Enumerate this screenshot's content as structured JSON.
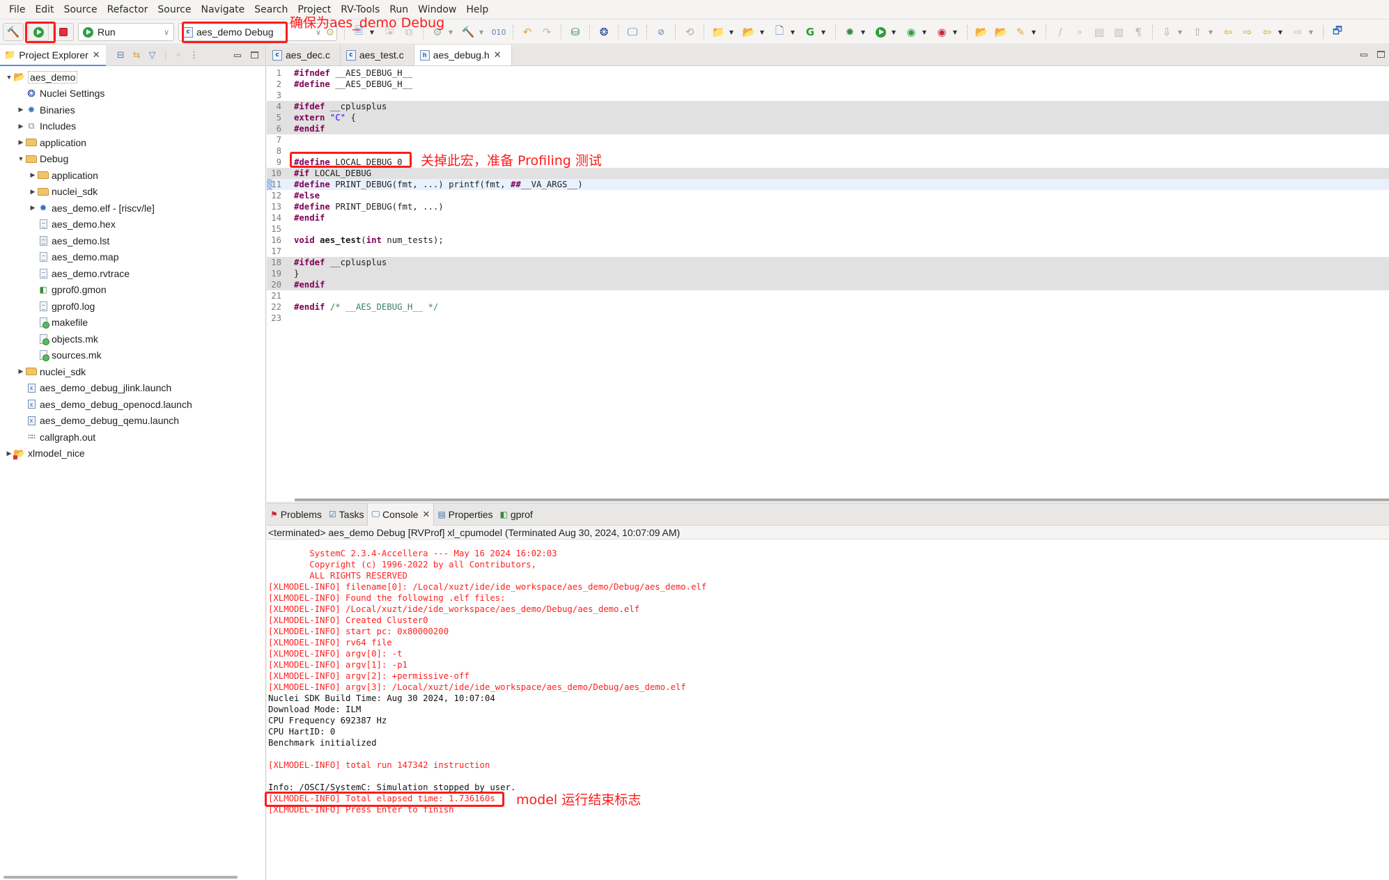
{
  "menu": [
    "File",
    "Edit",
    "Source",
    "Refactor",
    "Source",
    "Navigate",
    "Search",
    "Project",
    "RV-Tools",
    "Run",
    "Window",
    "Help"
  ],
  "toolbar": {
    "build_icon": "hammer-icon",
    "run_button_icon": "play-icon",
    "stop_button_icon": "stop-icon",
    "launch_mode": "Run",
    "launch_config": "aes_demo Debug"
  },
  "annotations": {
    "config_note": "确保为aes_demo Debug",
    "macro_note": "关掉此宏，准备 Profiling 测试",
    "finish_note": "model 运行结束标志",
    "color": "#ff1a1a"
  },
  "project_explorer": {
    "title": "Project Explorer",
    "items": [
      {
        "label": "aes_demo",
        "depth": 0,
        "twist": "open",
        "icon": "c-project-icon"
      },
      {
        "label": "Nuclei Settings",
        "depth": 1,
        "twist": "none",
        "icon": "nuclei-settings-icon"
      },
      {
        "label": "Binaries",
        "depth": 1,
        "twist": "closed",
        "icon": "binaries-icon"
      },
      {
        "label": "Includes",
        "depth": 1,
        "twist": "closed",
        "icon": "includes-icon"
      },
      {
        "label": "application",
        "depth": 1,
        "twist": "closed",
        "icon": "folder-icon"
      },
      {
        "label": "Debug",
        "depth": 1,
        "twist": "open",
        "icon": "folder-icon"
      },
      {
        "label": "application",
        "depth": 2,
        "twist": "closed",
        "icon": "folder-icon"
      },
      {
        "label": "nuclei_sdk",
        "depth": 2,
        "twist": "closed",
        "icon": "folder-icon"
      },
      {
        "label": "aes_demo.elf - [riscv/le]",
        "depth": 2,
        "twist": "closed",
        "icon": "elf-binary-icon"
      },
      {
        "label": "aes_demo.hex",
        "depth": 2,
        "twist": "none",
        "icon": "file-icon"
      },
      {
        "label": "aes_demo.lst",
        "depth": 2,
        "twist": "none",
        "icon": "listing-file-icon"
      },
      {
        "label": "aes_demo.map",
        "depth": 2,
        "twist": "none",
        "icon": "file-icon"
      },
      {
        "label": "aes_demo.rvtrace",
        "depth": 2,
        "twist": "none",
        "icon": "file-icon"
      },
      {
        "label": "gprof0.gmon",
        "depth": 2,
        "twist": "none",
        "icon": "gprof-icon"
      },
      {
        "label": "gprof0.log",
        "depth": 2,
        "twist": "none",
        "icon": "file-icon"
      },
      {
        "label": "makefile",
        "depth": 2,
        "twist": "none",
        "icon": "makefile-icon"
      },
      {
        "label": "objects.mk",
        "depth": 2,
        "twist": "none",
        "icon": "makefile-icon"
      },
      {
        "label": "sources.mk",
        "depth": 2,
        "twist": "none",
        "icon": "makefile-icon"
      },
      {
        "label": "nuclei_sdk",
        "depth": 1,
        "twist": "closed",
        "icon": "folder-icon"
      },
      {
        "label": "aes_demo_debug_jlink.launch",
        "depth": 1,
        "twist": "none",
        "icon": "launch-file-icon"
      },
      {
        "label": "aes_demo_debug_openocd.launch",
        "depth": 1,
        "twist": "none",
        "icon": "launch-file-icon"
      },
      {
        "label": "aes_demo_debug_qemu.launch",
        "depth": 1,
        "twist": "none",
        "icon": "launch-file-icon"
      },
      {
        "label": "callgraph.out",
        "depth": 1,
        "twist": "none",
        "icon": "binary-data-icon"
      },
      {
        "label": "xlmodel_nice",
        "depth": 0,
        "twist": "closed",
        "icon": "c-project-error-icon"
      }
    ]
  },
  "editor": {
    "tabs": [
      {
        "label": "aes_dec.c",
        "type": "c",
        "active": false
      },
      {
        "label": "aes_test.c",
        "type": "c",
        "active": false
      },
      {
        "label": "aes_debug.h",
        "type": "h",
        "active": true
      }
    ],
    "lines": [
      {
        "n": "1",
        "segs": [
          [
            "kw",
            "#ifndef"
          ],
          [
            "",
            " __AES_DEBUG_H__"
          ]
        ],
        "bg": ""
      },
      {
        "n": "2",
        "segs": [
          [
            "kw",
            "#define"
          ],
          [
            "",
            " __AES_DEBUG_H__"
          ]
        ],
        "bg": ""
      },
      {
        "n": "3",
        "segs": [],
        "bg": ""
      },
      {
        "n": "4",
        "segs": [
          [
            "kw",
            "#ifdef"
          ],
          [
            "",
            " __cplusplus"
          ]
        ],
        "bg": "shade"
      },
      {
        "n": "5",
        "segs": [
          [
            "kw",
            "extern"
          ],
          [
            "",
            " "
          ],
          [
            "str",
            "\"C\""
          ],
          [
            "",
            " {"
          ]
        ],
        "bg": "shade"
      },
      {
        "n": "6",
        "segs": [
          [
            "kw",
            "#endif"
          ]
        ],
        "bg": "shade"
      },
      {
        "n": "7",
        "segs": [],
        "bg": ""
      },
      {
        "n": "8",
        "segs": [],
        "bg": ""
      },
      {
        "n": "9",
        "segs": [
          [
            "kw",
            "#define"
          ],
          [
            "",
            " LOCAL_DEBUG 0"
          ]
        ],
        "bg": ""
      },
      {
        "n": "10",
        "segs": [
          [
            "kw",
            "#if"
          ],
          [
            "",
            " LOCAL_DEBUG"
          ]
        ],
        "bg": "shade"
      },
      {
        "n": "11",
        "segs": [
          [
            "kw",
            "#define"
          ],
          [
            "",
            " PRINT_DEBUG(fmt, ...) printf(fmt, "
          ],
          [
            "kw",
            "##"
          ],
          [
            "",
            "__VA_ARGS__)"
          ]
        ],
        "bg": "cur"
      },
      {
        "n": "12",
        "segs": [
          [
            "kw",
            "#else"
          ]
        ],
        "bg": ""
      },
      {
        "n": "13",
        "segs": [
          [
            "kw",
            "#define"
          ],
          [
            "",
            " PRINT_DEBUG(fmt, ...)"
          ]
        ],
        "bg": ""
      },
      {
        "n": "14",
        "segs": [
          [
            "kw",
            "#endif"
          ]
        ],
        "bg": ""
      },
      {
        "n": "15",
        "segs": [],
        "bg": ""
      },
      {
        "n": "16",
        "segs": [
          [
            "kw",
            "void"
          ],
          [
            "",
            " "
          ],
          [
            "bold",
            "aes_test"
          ],
          [
            "",
            "("
          ],
          [
            "kw",
            "int"
          ],
          [
            "",
            " num_tests);"
          ]
        ],
        "bg": ""
      },
      {
        "n": "17",
        "segs": [],
        "bg": ""
      },
      {
        "n": "18",
        "segs": [
          [
            "kw",
            "#ifdef"
          ],
          [
            "",
            " __cplusplus"
          ]
        ],
        "bg": "shade"
      },
      {
        "n": "19",
        "segs": [
          [
            "",
            "}"
          ]
        ],
        "bg": "shade"
      },
      {
        "n": "20",
        "segs": [
          [
            "kw",
            "#endif"
          ]
        ],
        "bg": "shade"
      },
      {
        "n": "21",
        "segs": [],
        "bg": ""
      },
      {
        "n": "22",
        "segs": [
          [
            "kw",
            "#endif"
          ],
          [
            "",
            " "
          ],
          [
            "cmt",
            "/* __AES_DEBUG_H__ */"
          ]
        ],
        "bg": ""
      },
      {
        "n": "23",
        "segs": [],
        "bg": ""
      }
    ]
  },
  "bottom_panel": {
    "tabs": [
      {
        "label": "Problems",
        "icon": "problems-icon",
        "active": false
      },
      {
        "label": "Tasks",
        "icon": "tasks-icon",
        "active": false
      },
      {
        "label": "Console",
        "icon": "console-icon",
        "active": true
      },
      {
        "label": "Properties",
        "icon": "properties-icon",
        "active": false
      },
      {
        "label": "gprof",
        "icon": "gprof-icon",
        "active": false
      }
    ],
    "description": "<terminated> aes_demo Debug [RVProf] xl_cpumodel (Terminated Aug 30, 2024, 10:07:09 AM)",
    "output": [
      {
        "text": "        SystemC 2.3.4-Accellera --- May 16 2024 16:02:03",
        "color": "red"
      },
      {
        "text": "        Copyright (c) 1996-2022 by all Contributors,",
        "color": "red"
      },
      {
        "text": "        ALL RIGHTS RESERVED",
        "color": "red"
      },
      {
        "text": "[XLMODEL-INFO] filename[0]: /Local/xuzt/ide/ide_workspace/aes_demo/Debug/aes_demo.elf",
        "color": "red"
      },
      {
        "text": "[XLMODEL-INFO] Found the following .elf files:",
        "color": "red"
      },
      {
        "text": "[XLMODEL-INFO] /Local/xuzt/ide/ide_workspace/aes_demo/Debug/aes_demo.elf",
        "color": "red"
      },
      {
        "text": "[XLMODEL-INFO] Created Cluster0",
        "color": "red"
      },
      {
        "text": "[XLMODEL-INFO] start pc: 0x80000200",
        "color": "red"
      },
      {
        "text": "[XLMODEL-INFO] rv64 file",
        "color": "red"
      },
      {
        "text": "[XLMODEL-INFO] argv[0]: -t",
        "color": "red"
      },
      {
        "text": "[XLMODEL-INFO] argv[1]: -p1",
        "color": "red"
      },
      {
        "text": "[XLMODEL-INFO] argv[2]: +permissive-off",
        "color": "red"
      },
      {
        "text": "[XLMODEL-INFO] argv[3]: /Local/xuzt/ide/ide_workspace/aes_demo/Debug/aes_demo.elf",
        "color": "red"
      },
      {
        "text": "Nuclei SDK Build Time: Aug 30 2024, 10:07:04",
        "color": "black"
      },
      {
        "text": "Download Mode: ILM",
        "color": "black"
      },
      {
        "text": "CPU Frequency 692387 Hz",
        "color": "black"
      },
      {
        "text": "CPU HartID: 0",
        "color": "black"
      },
      {
        "text": "Benchmark initialized",
        "color": "black"
      },
      {
        "text": "",
        "color": "black"
      },
      {
        "text": "[XLMODEL-INFO] total run 147342 instruction",
        "color": "red"
      },
      {
        "text": "",
        "color": "black"
      },
      {
        "text": "Info: /OSCI/SystemC: Simulation stopped by user.",
        "color": "black"
      },
      {
        "text": "[XLMODEL-INFO] Total elapsed time: 1.736160s",
        "color": "red"
      },
      {
        "text": "[XLMODEL-INFO] Press Enter to finish",
        "color": "red"
      }
    ]
  }
}
